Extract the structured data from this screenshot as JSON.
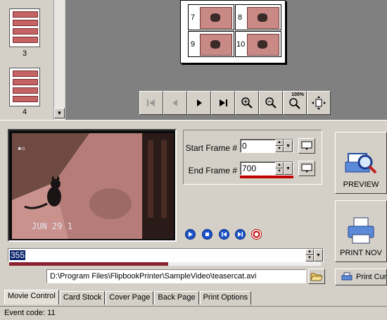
{
  "thumbnails": [
    {
      "label": "3"
    },
    {
      "label": "4"
    }
  ],
  "preview_page": {
    "cells": [
      {
        "num": "7"
      },
      {
        "num": "8"
      },
      {
        "num": "9"
      },
      {
        "num": "10"
      }
    ]
  },
  "nav_toolbar": [
    {
      "name": "first-page-button",
      "icon": "first-icon"
    },
    {
      "name": "prev-page-button",
      "icon": "prev-icon"
    },
    {
      "name": "next-page-button",
      "icon": "next-icon"
    },
    {
      "name": "last-page-button",
      "icon": "last-icon"
    },
    {
      "name": "zoom-in-button",
      "icon": "zoom-in-icon"
    },
    {
      "name": "zoom-out-button",
      "icon": "zoom-out-icon"
    },
    {
      "name": "zoom-100-button",
      "icon": "zoom-100-icon",
      "badge": "100%"
    },
    {
      "name": "fit-page-button",
      "icon": "fit-page-icon"
    }
  ],
  "video": {
    "timestamp": "JUN 29 1"
  },
  "frames": {
    "start_label": "Start Frame #",
    "start_value": "0",
    "end_label": "End Frame #",
    "end_value": "700"
  },
  "side_buttons": {
    "preview_label": "PREVIEW",
    "print_now_label": "PRINT NOV",
    "print_current_label": "Print Curr"
  },
  "position": {
    "value": "355",
    "progress": 0.51
  },
  "file_path": "D:\\Program Files\\FlipbookPrinter\\SampleVideo\\teasercat.avi",
  "tabs": [
    {
      "label": "Movie Control",
      "active": true
    },
    {
      "label": "Card Stock"
    },
    {
      "label": "Cover Page"
    },
    {
      "label": "Back Page"
    },
    {
      "label": "Print Options"
    }
  ],
  "status": "Event code: 11",
  "colors": {
    "accent_red": "#c00000",
    "video_tint": "#b87d7a",
    "selection": "#0a246a"
  }
}
